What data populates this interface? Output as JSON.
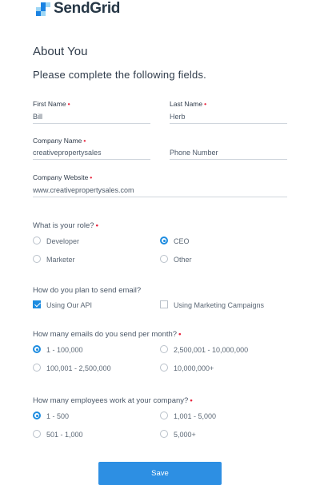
{
  "brand": {
    "name": "SendGrid",
    "colors": [
      "#9dd6f5",
      "#1a82e2",
      "#9dd6f5"
    ]
  },
  "header": {
    "title": "About You",
    "subtitle": "Please complete the following fields."
  },
  "fields": {
    "first_name": {
      "label": "First Name",
      "value": "Bill",
      "required": true
    },
    "last_name": {
      "label": "Last Name",
      "value": "Herb",
      "required": true
    },
    "company_name": {
      "label": "Company Name",
      "value": "creativepropertysales",
      "required": true
    },
    "phone_number": {
      "placeholder": "Phone Number"
    },
    "company_website": {
      "label": "Company Website",
      "value": "www.creativepropertysales.com",
      "required": true
    }
  },
  "role": {
    "question": "What is your role?",
    "options": [
      "Developer",
      "CEO",
      "Marketer",
      "Other"
    ],
    "selected": "CEO"
  },
  "send_method": {
    "question": "How do you plan to send email?",
    "options": [
      {
        "label": "Using Our API",
        "checked": true
      },
      {
        "label": "Using Marketing Campaigns",
        "checked": false
      }
    ]
  },
  "emails_per_month": {
    "question": "How many emails do you send per month?",
    "options": [
      "1 - 100,000",
      "2,500,001 - 10,000,000",
      "100,001 - 2,500,000",
      "10,000,000+"
    ],
    "selected": "1 - 100,000"
  },
  "employees": {
    "question": "How many employees work at your company?",
    "options": [
      "1 - 500",
      "1,001 - 5,000",
      "501 - 1,000",
      "5,000+"
    ],
    "selected": "1 - 500"
  },
  "actions": {
    "save_label": "Save"
  },
  "theme": {
    "accent": "#1d8ce0",
    "required": "#e8243d",
    "button": "#2d8fe3"
  }
}
